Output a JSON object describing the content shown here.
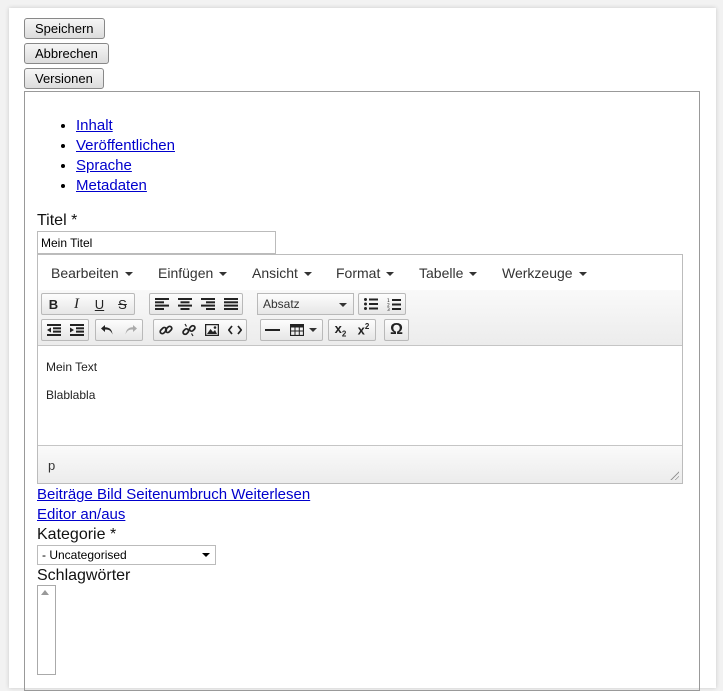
{
  "buttons": {
    "save": "Speichern",
    "cancel": "Abbrechen",
    "versions": "Versionen"
  },
  "tabs": [
    "Inhalt",
    "Veröffentlichen",
    "Sprache",
    "Metadaten"
  ],
  "title_field": {
    "label": "Titel *",
    "value": "Mein Titel"
  },
  "editor": {
    "menu": [
      "Bearbeiten",
      "Einfügen",
      "Ansicht",
      "Format",
      "Tabelle",
      "Werkzeuge"
    ],
    "format_select": "Absatz",
    "content": [
      "Mein Text",
      "Blablabla"
    ],
    "status_path": "p",
    "toolbar_icons": [
      "bold-icon",
      "italic-icon",
      "underline-icon",
      "strikethrough-icon",
      "align-left-icon",
      "align-center-icon",
      "align-right-icon",
      "align-justify-icon",
      "bullet-list-icon",
      "numbered-list-icon",
      "outdent-icon",
      "indent-icon",
      "undo-icon",
      "redo-icon",
      "link-icon",
      "unlink-icon",
      "image-icon",
      "code-icon",
      "horizontal-rule-icon",
      "table-icon",
      "subscript-icon",
      "superscript-icon",
      "special-character-icon"
    ]
  },
  "editor_buttons": "Beiträge Bild Seitenumbruch Weiterlesen",
  "toggle_editor": "Editor an/aus",
  "category": {
    "label": "Kategorie *",
    "value": "- Uncategorised"
  },
  "tags": {
    "label": "Schlagwörter"
  }
}
